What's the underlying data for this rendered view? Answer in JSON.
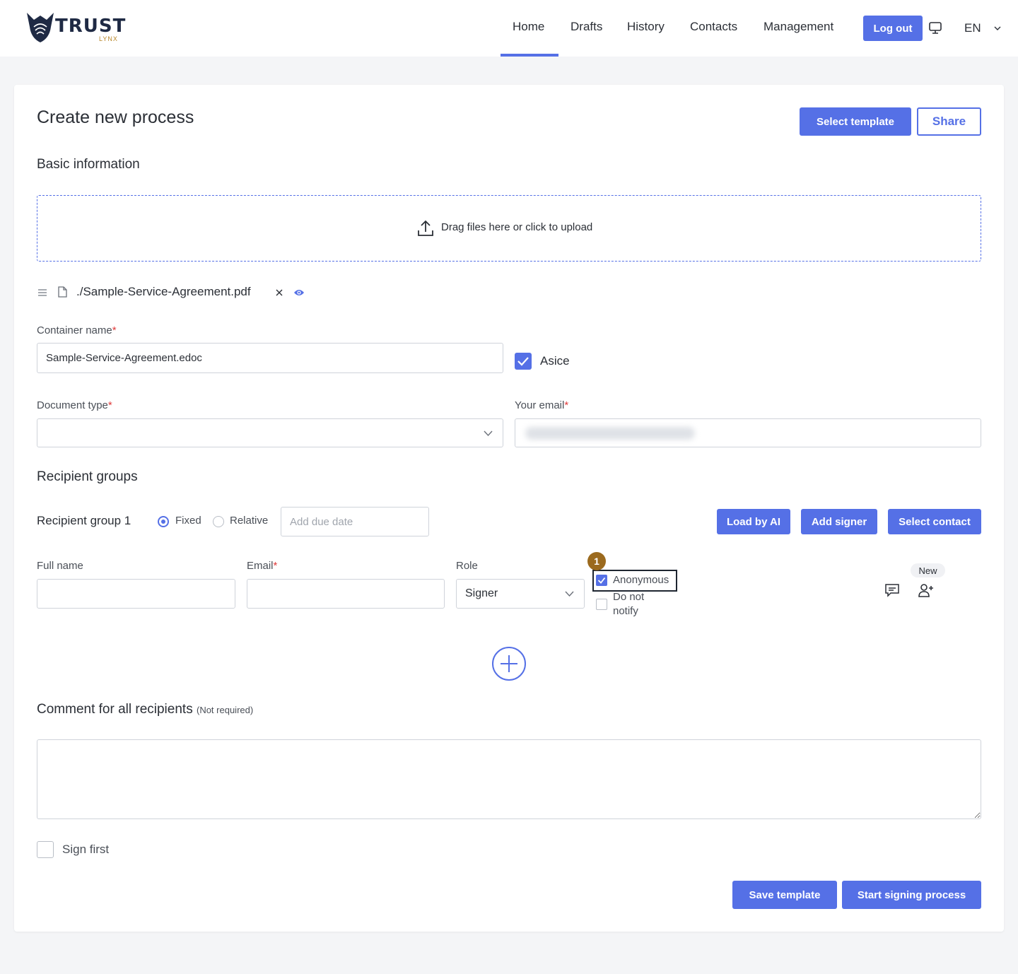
{
  "header": {
    "logo_text": "TRUST",
    "logo_sub": "LYNX",
    "nav": [
      "Home",
      "Drafts",
      "History",
      "Contacts",
      "Management"
    ],
    "active_nav": "Home",
    "logout_label": "Log out",
    "language": "EN"
  },
  "page": {
    "title": "Create new process",
    "select_template_label": "Select template",
    "share_label": "Share"
  },
  "basic": {
    "section_title": "Basic information",
    "upload_label": "Drag files here or click to upload",
    "file_name": "./Sample-Service-Agreement.pdf",
    "container_label": "Container name",
    "container_value": "Sample-Service-Agreement.edoc",
    "asice_label": "Asice",
    "asice_checked": true,
    "doc_type_label": "Document type",
    "doc_type_value": "",
    "email_label": "Your email",
    "email_value": "",
    "required_mark": "*"
  },
  "recipients": {
    "section_title": "Recipient groups",
    "group_label": "Recipient group 1",
    "fixed_label": "Fixed",
    "relative_label": "Relative",
    "due_date_placeholder": "Add due date",
    "load_ai_label": "Load by AI",
    "add_signer_label": "Add signer",
    "select_contact_label": "Select contact",
    "full_name_label": "Full name",
    "email_label": "Email",
    "role_label": "Role",
    "role_value": "Signer",
    "anonymous_label": "Anonymous",
    "anonymous_checked": true,
    "do_not_notify_label_1": "Do not",
    "do_not_notify_label_2": "notify",
    "new_badge": "New",
    "step_badge": "1"
  },
  "comment": {
    "title": "Comment for all recipients",
    "note": "(Not required)",
    "value": ""
  },
  "footer": {
    "sign_first_label": "Sign first",
    "save_template_label": "Save template",
    "start_signing_label": "Start signing process"
  },
  "colors": {
    "accent": "#5570e6",
    "badge": "#9b6a1e"
  }
}
